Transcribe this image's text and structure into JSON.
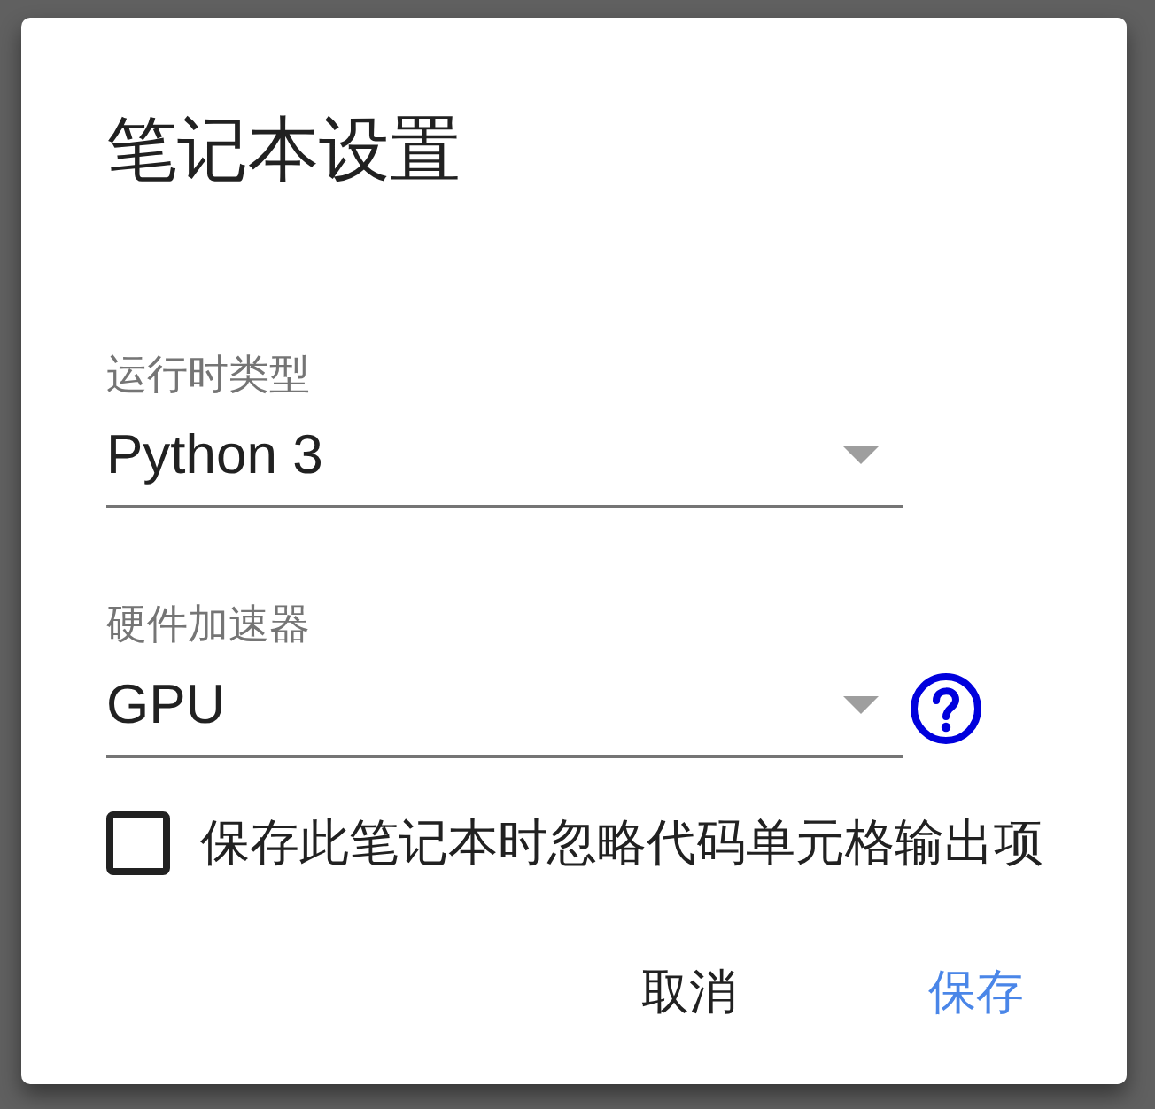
{
  "dialog": {
    "title": "笔记本设置",
    "fields": [
      {
        "label": "运行时类型",
        "value": "Python 3",
        "help": false
      },
      {
        "label": "硬件加速器",
        "value": "GPU",
        "help": true
      }
    ],
    "checkbox": {
      "label": "保存此笔记本时忽略代码单元格输出项",
      "checked": false
    },
    "buttons": [
      {
        "label": "取消",
        "kind": "secondary"
      },
      {
        "label": "保存",
        "kind": "primary"
      }
    ]
  }
}
